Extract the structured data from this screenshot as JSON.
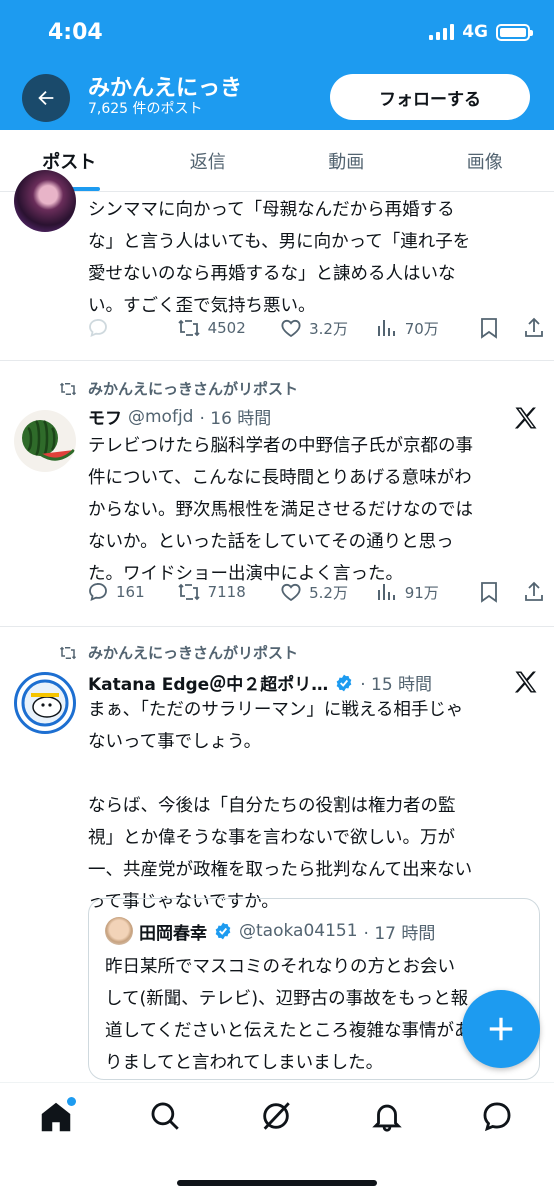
{
  "status": {
    "time": "4:04",
    "network": "4G"
  },
  "header": {
    "name": "みかんえにっき",
    "post_count": "7,625 件のポスト",
    "follow_label": "フォローする"
  },
  "tabs": [
    {
      "label": "ポスト"
    },
    {
      "label": "返信"
    },
    {
      "label": "動画"
    },
    {
      "label": "画像"
    }
  ],
  "tweets": [
    {
      "text_lines": [
        "シンママに向かって「母親なんだから再婚する",
        "な」と言う人はいても、男に向かって「連れ子を",
        "愛せないのなら再婚するな」と諌める人はいな",
        "い。すごく歪で気持ち悪い。"
      ],
      "reposts": "4502",
      "likes": "3.2万",
      "views": "70万"
    },
    {
      "repost_label": "みかんえにっきさんがリポスト",
      "name": "モフ",
      "handle": "@mofjd",
      "time": "· 16 時間",
      "text_lines": [
        "テレビつけたら脳科学者の中野信子氏が京都の事",
        "件について、こんなに長時間とりあげる意味がわ",
        "からない。野次馬根性を満足させるだけなのでは",
        "ないか。といった話をしていてその通りと思っ",
        "た。ワイドショー出演中によく言った。"
      ],
      "replies": "161",
      "reposts": "7118",
      "likes": "5.2万",
      "views": "91万"
    },
    {
      "repost_label": "みかんえにっきさんがリポスト",
      "name": "Katana Edge＠中２超ポリ…",
      "time": "· 15 時間",
      "text_lines_1": [
        "まぁ、「ただのサラリーマン」に戦える相手じゃ",
        "ないって事でしょう。"
      ],
      "text_lines_2": [
        "ならば、今後は「自分たちの役割は権力者の監",
        "視」とか偉そうな事を言わないで欲しい。万が",
        "一、共産党が政権を取ったら批判なんて出来ない",
        "って事じゃないですか。"
      ],
      "quote": {
        "name": "田岡春幸",
        "handle": "@taoka04151",
        "time": "· 17 時間",
        "text_lines": [
          "昨日某所でマスコミのそれなりの方とお会い",
          "して(新聞、テレビ)、辺野古の事故をもっと報",
          "道してくださいと伝えたところ複雑な事情があ",
          "りましてと言われてしまいました。"
        ]
      }
    }
  ],
  "colors": {
    "brand": "#1d9bf0",
    "muted": "#536471",
    "text": "#0f1419"
  }
}
